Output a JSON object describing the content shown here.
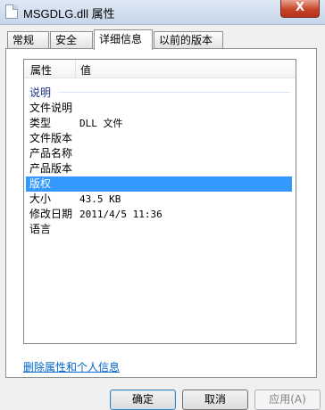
{
  "window": {
    "title": "MSGDLG.dll 属性",
    "close_label": "X"
  },
  "tabs": [
    {
      "label": "常规"
    },
    {
      "label": "安全"
    },
    {
      "label": "详细信息"
    },
    {
      "label": "以前的版本"
    }
  ],
  "list": {
    "col_property": "属性",
    "col_value": "值",
    "group": "说明",
    "rows": [
      {
        "key": "文件说明",
        "value": ""
      },
      {
        "key": "类型",
        "value": "DLL 文件"
      },
      {
        "key": "文件版本",
        "value": ""
      },
      {
        "key": "产品名称",
        "value": ""
      },
      {
        "key": "产品版本",
        "value": ""
      },
      {
        "key": "版权",
        "value": ""
      },
      {
        "key": "大小",
        "value": "43.5 KB"
      },
      {
        "key": "修改日期",
        "value": "2011/4/5 11:36"
      },
      {
        "key": "语言",
        "value": ""
      }
    ]
  },
  "link": "删除属性和个人信息",
  "buttons": {
    "ok": "确定",
    "cancel": "取消",
    "apply": "应用(A)"
  }
}
